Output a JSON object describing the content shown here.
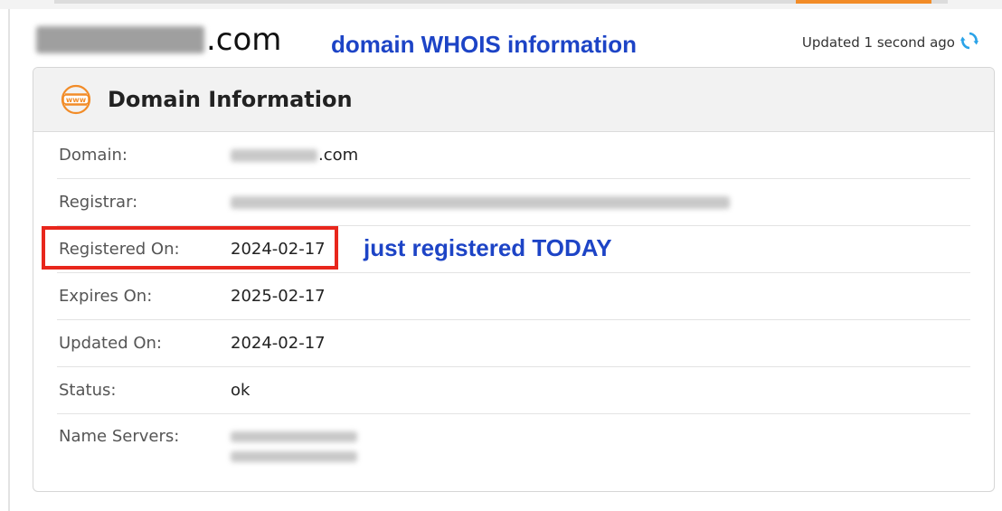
{
  "header": {
    "domain_suffix": ".com",
    "updated_text": "Updated 1 second ago",
    "refresh_icon": "refresh-icon"
  },
  "annotations": {
    "whois": "domain WHOIS information",
    "today": "just registered TODAY",
    "highlight_color": "#e8261c",
    "note_color": "#1d44c6"
  },
  "card": {
    "title": "Domain Information",
    "icon": "www-icon",
    "rows": [
      {
        "label": "Domain:",
        "value": ".com"
      },
      {
        "label": "Registrar:",
        "value": ""
      },
      {
        "label": "Registered On:",
        "value": "2024-02-17"
      },
      {
        "label": "Expires On:",
        "value": "2025-02-17"
      },
      {
        "label": "Updated On:",
        "value": "2024-02-17"
      },
      {
        "label": "Status:",
        "value": "ok"
      },
      {
        "label": "Name Servers:",
        "value": ""
      }
    ]
  }
}
